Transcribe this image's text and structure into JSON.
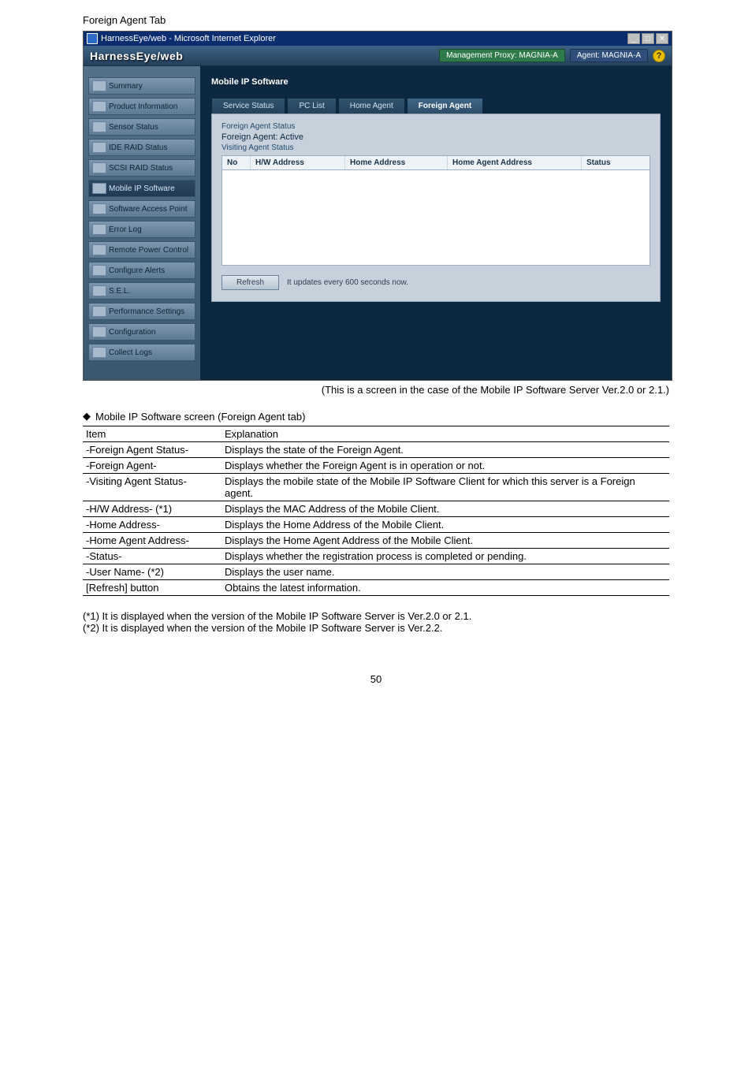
{
  "page": {
    "section_title": "Foreign Agent Tab",
    "caption_below": "(This is a screen in the case of the Mobile IP Software Server Ver.2.0 or 2.1.)",
    "subheading": "Mobile IP Software screen (Foreign Agent tab)",
    "footnote1": "(*1) It is displayed when the version of the Mobile IP Software Server is Ver.2.0 or 2.1.",
    "footnote2": "(*2) It is displayed when the version of the Mobile IP Software Server is Ver.2.2.",
    "page_number": "50"
  },
  "window": {
    "title": "HarnessEye/web - Microsoft Internet Explorer",
    "brand": "HarnessEye/web",
    "proxy_chip": "Management Proxy: MAGNIA-A",
    "agent_chip": "Agent: MAGNIA-A",
    "help": "?"
  },
  "sidebar": {
    "items": [
      {
        "label": "Summary"
      },
      {
        "label": "Product Information"
      },
      {
        "label": "Sensor Status"
      },
      {
        "label": "IDE RAID Status"
      },
      {
        "label": "SCSI RAID Status"
      },
      {
        "label": "Mobile IP Software"
      },
      {
        "label": "Software Access Point"
      },
      {
        "label": "Error Log"
      },
      {
        "label": "Remote Power Control"
      },
      {
        "label": "Configure Alerts"
      },
      {
        "label": "S.E.L."
      },
      {
        "label": "Performance Settings"
      },
      {
        "label": "Configuration"
      },
      {
        "label": "Collect Logs"
      }
    ]
  },
  "main": {
    "panel_title": "Mobile IP Software",
    "tabs": {
      "service_status": "Service Status",
      "pc_list": "PC List",
      "home_agent": "Home Agent",
      "foreign_agent": "Foreign Agent"
    },
    "fa_status_caption": "Foreign Agent Status",
    "fa_status_value": "Foreign Agent:   Active",
    "va_caption": "Visiting Agent Status",
    "cols": {
      "no": "No",
      "hw": "H/W Address",
      "home": "Home Address",
      "ha": "Home Agent Address",
      "status": "Status"
    },
    "refresh_label": "Refresh",
    "update_text": "It updates every 600 seconds now."
  },
  "table": {
    "header_item": "Item",
    "header_exp": "Explanation",
    "rows": [
      {
        "item": "-Foreign Agent Status-",
        "exp": "Displays the state of the Foreign Agent."
      },
      {
        "item": "-Foreign Agent-",
        "exp": "Displays whether the Foreign Agent is in operation or not."
      },
      {
        "item": "-Visiting Agent Status-",
        "exp": "Displays the mobile state of the Mobile IP Software Client for which this server is a Foreign agent."
      },
      {
        "item": "-H/W Address- (*1)",
        "exp": "Displays the MAC Address of the Mobile Client."
      },
      {
        "item": "-Home Address-",
        "exp": "Displays the Home Address of the Mobile Client."
      },
      {
        "item": "-Home Agent Address-",
        "exp": "Displays the Home Agent Address of the Mobile Client."
      },
      {
        "item": "-Status-",
        "exp": "Displays whether the registration process is completed or pending."
      },
      {
        "item": "-User Name- (*2)",
        "exp": "Displays the user name."
      },
      {
        "item": "[Refresh] button",
        "exp": "Obtains the latest information."
      }
    ]
  }
}
